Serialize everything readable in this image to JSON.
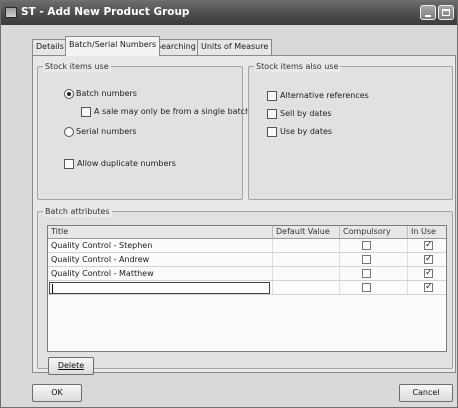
{
  "window": {
    "title": "ST - Add New Product Group"
  },
  "tabs": [
    {
      "label": "Details",
      "active": false
    },
    {
      "label": "Batch/Serial Numbers",
      "active": true
    },
    {
      "label": "Searching",
      "active": false
    },
    {
      "label": "Units of Measure",
      "active": false
    }
  ],
  "stock_items_use": {
    "legend": "Stock items use",
    "batch_numbers": "Batch numbers",
    "single_batch": "A sale may only be from a single batch",
    "serial_numbers": "Serial numbers",
    "allow_duplicate": "Allow duplicate numbers",
    "selected": "Batch numbers"
  },
  "stock_items_also_use": {
    "legend": "Stock items also use",
    "alt_refs": "Alternative references",
    "sell_by": "Sell by dates",
    "use_by": "Use by dates"
  },
  "batch_attributes": {
    "legend": "Batch attributes",
    "columns": [
      "Title",
      "Default Value",
      "Compulsory",
      "In Use"
    ],
    "rows": [
      {
        "title": "Quality Control - Stephen",
        "default": "",
        "compulsory": false,
        "in_use": true
      },
      {
        "title": "Quality Control - Andrew",
        "default": "",
        "compulsory": false,
        "in_use": true
      },
      {
        "title": "Quality Control - Matthew",
        "default": "",
        "compulsory": false,
        "in_use": true
      },
      {
        "title": "",
        "default": "",
        "compulsory": false,
        "in_use": true
      }
    ],
    "delete_button": "Delete"
  },
  "footer": {
    "ok": "OK",
    "cancel": "Cancel"
  }
}
